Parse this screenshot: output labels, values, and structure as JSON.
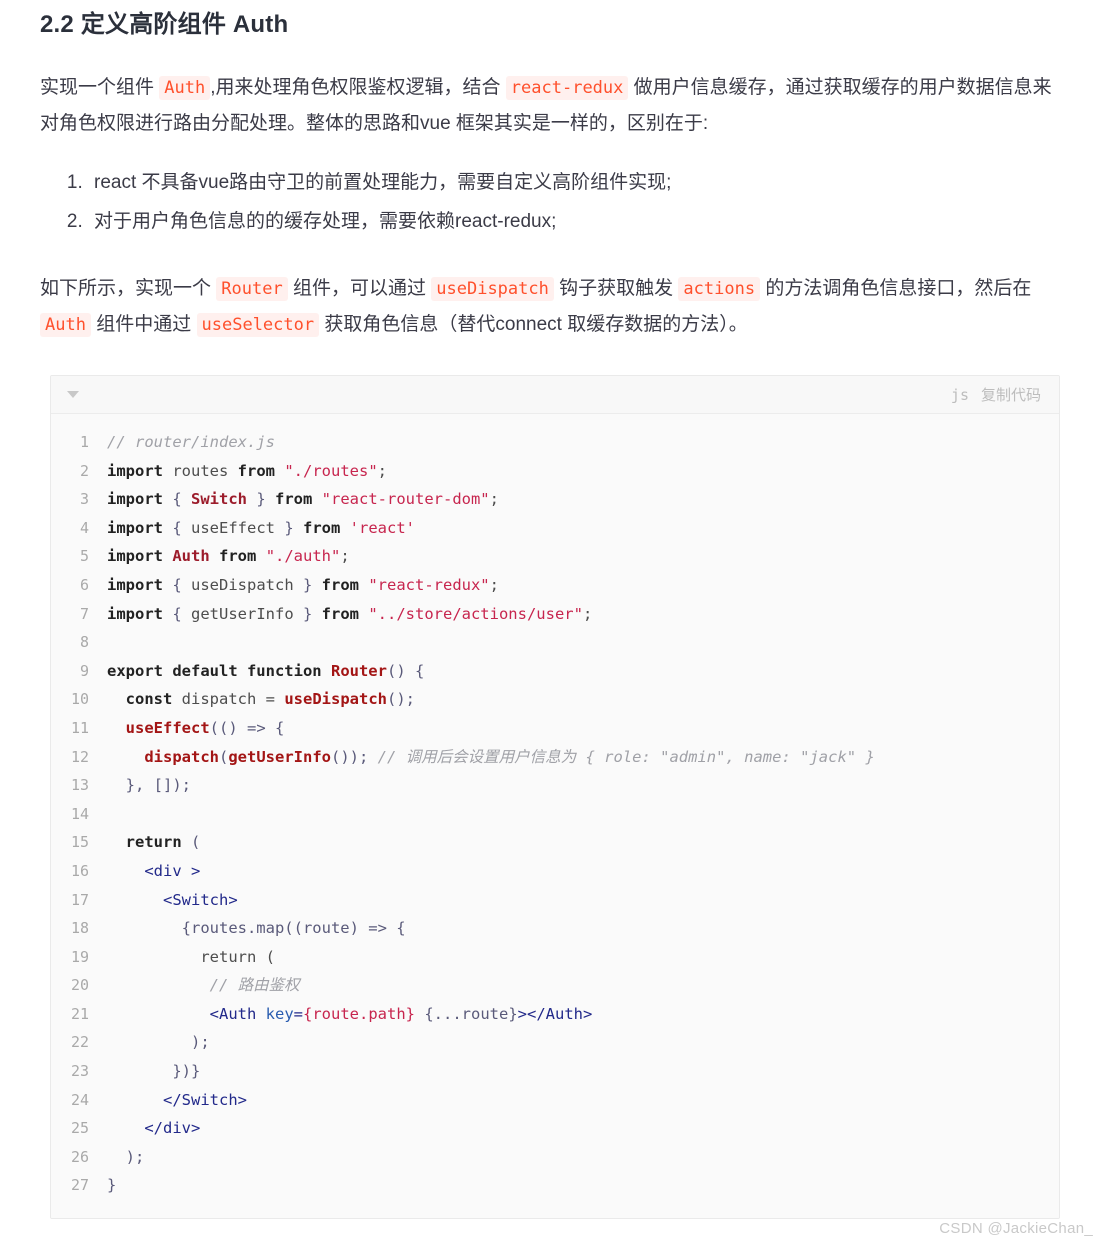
{
  "heading": "2.2 定义高阶组件 Auth",
  "paragraph1": {
    "seg1": "实现一个组件 ",
    "code1": "Auth",
    "seg2": ",用来处理角色权限鉴权逻辑，结合 ",
    "code2": "react-redux",
    "seg3": " 做用户信息缓存，通过获取缓存的用户数据信息来对角色权限进行路由分配处理。整体的思路和vue 框架其实是一样的，区别在于:"
  },
  "list": [
    "react 不具备vue路由守卫的前置处理能力，需要自定义高阶组件实现;",
    "对于用户角色信息的的缓存处理，需要依赖react-redux;"
  ],
  "paragraph2": {
    "seg1": "如下所示，实现一个 ",
    "code1": "Router",
    "seg2": " 组件，可以通过 ",
    "code2": "useDispatch",
    "seg3": " 钩子获取触发 ",
    "code3": "actions",
    "seg4": " 的方法调角色信息接口，然后在 ",
    "code4": "Auth",
    "seg5": " 组件中通过 ",
    "code5": "useSelector",
    "seg6": " 获取角色信息（替代connect 取缓存数据的方法）。"
  },
  "codeblock": {
    "language": "js",
    "copy_label": "复制代码",
    "collapse_icon": "triangle-down-icon",
    "lines": [
      {
        "n": "1",
        "tokens": [
          {
            "t": "comment",
            "v": "// router/index.js"
          }
        ]
      },
      {
        "n": "2",
        "tokens": [
          {
            "t": "keyword",
            "v": "import"
          },
          {
            "t": "plain",
            "v": " routes "
          },
          {
            "t": "keyword",
            "v": "from"
          },
          {
            "t": "plain",
            "v": " "
          },
          {
            "t": "string",
            "v": "\"./routes\""
          },
          {
            "t": "plain",
            "v": ";"
          }
        ]
      },
      {
        "n": "3",
        "tokens": [
          {
            "t": "keyword",
            "v": "import"
          },
          {
            "t": "punct",
            "v": " { "
          },
          {
            "t": "class",
            "v": "Switch"
          },
          {
            "t": "punct",
            "v": " } "
          },
          {
            "t": "keyword",
            "v": "from"
          },
          {
            "t": "plain",
            "v": " "
          },
          {
            "t": "string",
            "v": "\"react-router-dom\""
          },
          {
            "t": "plain",
            "v": ";"
          }
        ]
      },
      {
        "n": "4",
        "tokens": [
          {
            "t": "keyword",
            "v": "import"
          },
          {
            "t": "punct",
            "v": " { "
          },
          {
            "t": "plain",
            "v": "useEffect"
          },
          {
            "t": "punct",
            "v": " } "
          },
          {
            "t": "keyword",
            "v": "from"
          },
          {
            "t": "plain",
            "v": " "
          },
          {
            "t": "string",
            "v": "'react'"
          }
        ]
      },
      {
        "n": "5",
        "tokens": [
          {
            "t": "keyword",
            "v": "import"
          },
          {
            "t": "plain",
            "v": " "
          },
          {
            "t": "class",
            "v": "Auth"
          },
          {
            "t": "plain",
            "v": " "
          },
          {
            "t": "keyword",
            "v": "from"
          },
          {
            "t": "plain",
            "v": " "
          },
          {
            "t": "string",
            "v": "\"./auth\""
          },
          {
            "t": "plain",
            "v": ";"
          }
        ]
      },
      {
        "n": "6",
        "tokens": [
          {
            "t": "keyword",
            "v": "import"
          },
          {
            "t": "punct",
            "v": " { "
          },
          {
            "t": "plain",
            "v": "useDispatch"
          },
          {
            "t": "punct",
            "v": " } "
          },
          {
            "t": "keyword",
            "v": "from"
          },
          {
            "t": "plain",
            "v": " "
          },
          {
            "t": "string",
            "v": "\"react-redux\""
          },
          {
            "t": "plain",
            "v": ";"
          }
        ]
      },
      {
        "n": "7",
        "tokens": [
          {
            "t": "keyword",
            "v": "import"
          },
          {
            "t": "punct",
            "v": " { "
          },
          {
            "t": "plain",
            "v": "getUserInfo"
          },
          {
            "t": "punct",
            "v": " } "
          },
          {
            "t": "keyword",
            "v": "from"
          },
          {
            "t": "plain",
            "v": " "
          },
          {
            "t": "string",
            "v": "\"../store/actions/user\""
          },
          {
            "t": "plain",
            "v": ";"
          }
        ]
      },
      {
        "n": "8",
        "tokens": []
      },
      {
        "n": "9",
        "tokens": [
          {
            "t": "keyword",
            "v": "export default function"
          },
          {
            "t": "plain",
            "v": " "
          },
          {
            "t": "func",
            "v": "Router"
          },
          {
            "t": "punct",
            "v": "() {"
          }
        ]
      },
      {
        "n": "10",
        "tokens": [
          {
            "t": "plain",
            "v": "  "
          },
          {
            "t": "keyword",
            "v": "const"
          },
          {
            "t": "plain",
            "v": " dispatch = "
          },
          {
            "t": "func",
            "v": "useDispatch"
          },
          {
            "t": "punct",
            "v": "();"
          }
        ]
      },
      {
        "n": "11",
        "tokens": [
          {
            "t": "plain",
            "v": "  "
          },
          {
            "t": "func",
            "v": "useEffect"
          },
          {
            "t": "punct",
            "v": "(() => {"
          }
        ]
      },
      {
        "n": "12",
        "tokens": [
          {
            "t": "plain",
            "v": "    "
          },
          {
            "t": "func",
            "v": "dispatch"
          },
          {
            "t": "punct",
            "v": "("
          },
          {
            "t": "func",
            "v": "getUserInfo"
          },
          {
            "t": "punct",
            "v": "());"
          },
          {
            "t": "plain",
            "v": " "
          },
          {
            "t": "comment",
            "v": "// 调用后会设置用户信息为 { role: \"admin\", name: \"jack\" }"
          }
        ]
      },
      {
        "n": "13",
        "tokens": [
          {
            "t": "punct",
            "v": "  }, []);"
          }
        ]
      },
      {
        "n": "14",
        "tokens": []
      },
      {
        "n": "15",
        "tokens": [
          {
            "t": "plain",
            "v": "  "
          },
          {
            "t": "keyword",
            "v": "return"
          },
          {
            "t": "punct",
            "v": " ("
          }
        ]
      },
      {
        "n": "16",
        "tokens": [
          {
            "t": "plain",
            "v": "    "
          },
          {
            "t": "tag",
            "v": "<div >"
          }
        ]
      },
      {
        "n": "17",
        "tokens": [
          {
            "t": "plain",
            "v": "      "
          },
          {
            "t": "tag",
            "v": "<Switch>"
          }
        ]
      },
      {
        "n": "18",
        "tokens": [
          {
            "t": "punct",
            "v": "        {routes.map((route) => {"
          }
        ]
      },
      {
        "n": "19",
        "tokens": [
          {
            "t": "plain",
            "v": "          "
          },
          {
            "t": "plain",
            "v": "return ("
          }
        ]
      },
      {
        "n": "20",
        "tokens": [
          {
            "t": "plain",
            "v": "           "
          },
          {
            "t": "comment",
            "v": "// 路由鉴权"
          }
        ]
      },
      {
        "n": "21",
        "tokens": [
          {
            "t": "plain",
            "v": "           "
          },
          {
            "t": "tag",
            "v": "<Auth"
          },
          {
            "t": "plain",
            "v": " "
          },
          {
            "t": "attr",
            "v": "key"
          },
          {
            "t": "tag",
            "v": "="
          },
          {
            "t": "num",
            "v": "{route.path}"
          },
          {
            "t": "plain",
            "v": " "
          },
          {
            "t": "punct",
            "v": "{...route}"
          },
          {
            "t": "tag",
            "v": "></Auth>"
          }
        ]
      },
      {
        "n": "22",
        "tokens": [
          {
            "t": "punct",
            "v": "         );"
          }
        ]
      },
      {
        "n": "23",
        "tokens": [
          {
            "t": "punct",
            "v": "       })}"
          }
        ]
      },
      {
        "n": "24",
        "tokens": [
          {
            "t": "plain",
            "v": "      "
          },
          {
            "t": "tag",
            "v": "</Switch>"
          }
        ]
      },
      {
        "n": "25",
        "tokens": [
          {
            "t": "plain",
            "v": "    "
          },
          {
            "t": "tag",
            "v": "</div>"
          }
        ]
      },
      {
        "n": "26",
        "tokens": [
          {
            "t": "punct",
            "v": "  );"
          }
        ]
      },
      {
        "n": "27",
        "tokens": [
          {
            "t": "punct",
            "v": "}"
          }
        ]
      }
    ]
  },
  "watermark": "CSDN @JackieChan_",
  "colors": {
    "inline_code_text": "#ff502c",
    "inline_code_bg": "#fff0ee",
    "code_bg": "#fafafa",
    "string": "#c7254e",
    "tag": "#22298a",
    "comment": "#a0a1a7",
    "func": "#a31515"
  }
}
